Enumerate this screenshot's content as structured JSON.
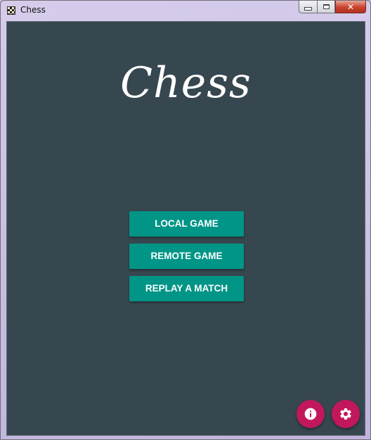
{
  "window": {
    "title": "Chess",
    "close_glyph": "✕"
  },
  "main": {
    "title": "Chess",
    "buttons": [
      {
        "label": "LOCAL GAME"
      },
      {
        "label": "REMOTE GAME"
      },
      {
        "label": "REPLAY A MATCH"
      }
    ]
  },
  "fabs": {
    "info_icon": "info-icon",
    "settings_icon": "gear-icon"
  },
  "colors": {
    "background": "#37474f",
    "button": "#009587",
    "fab": "#c2185b",
    "text": "#ffffff"
  }
}
